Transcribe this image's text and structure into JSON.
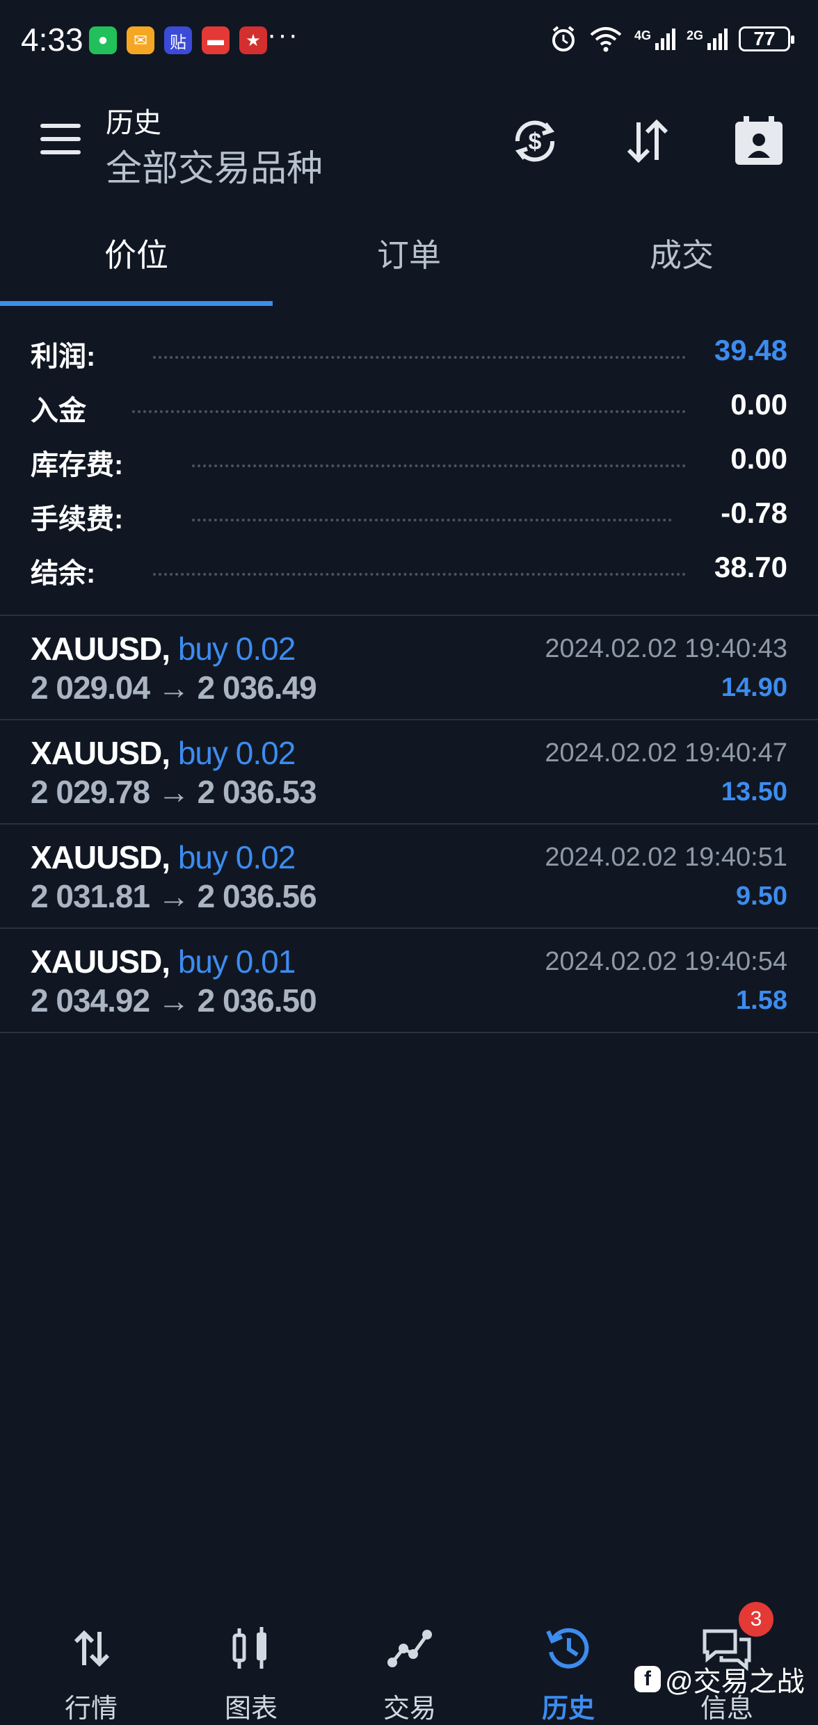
{
  "status_bar": {
    "time": "4:33",
    "battery": "77",
    "apps": [
      "wechat-icon",
      "mail-icon",
      "tieba-icon",
      "red-packet-icon",
      "game-icon"
    ],
    "more": "···",
    "net1": "4G",
    "net2": "2G"
  },
  "header": {
    "title": "历史",
    "subtitle": "全部交易品种"
  },
  "tabs": [
    {
      "label": "价位",
      "active": true
    },
    {
      "label": "订单",
      "active": false
    },
    {
      "label": "成交",
      "active": false
    }
  ],
  "summary": [
    {
      "label": "利润:",
      "value": "39.48",
      "highlight": true
    },
    {
      "label": "入金",
      "value": "0.00",
      "highlight": false
    },
    {
      "label": "库存费:",
      "value": "0.00",
      "highlight": false
    },
    {
      "label": "手续费:",
      "value": "-0.78",
      "highlight": false
    },
    {
      "label": "结余:",
      "value": "38.70",
      "highlight": false
    }
  ],
  "trades": [
    {
      "symbol": "XAUUSD,",
      "side": "buy 0.02",
      "open": "2 029.04",
      "close": "2 036.49",
      "time": "2024.02.02 19:40:43",
      "profit": "14.90"
    },
    {
      "symbol": "XAUUSD,",
      "side": "buy 0.02",
      "open": "2 029.78",
      "close": "2 036.53",
      "time": "2024.02.02 19:40:47",
      "profit": "13.50"
    },
    {
      "symbol": "XAUUSD,",
      "side": "buy 0.02",
      "open": "2 031.81",
      "close": "2 036.56",
      "time": "2024.02.02 19:40:51",
      "profit": "9.50"
    },
    {
      "symbol": "XAUUSD,",
      "side": "buy 0.01",
      "open": "2 034.92",
      "close": "2 036.50",
      "time": "2024.02.02 19:40:54",
      "profit": "1.58"
    }
  ],
  "arrow": "→",
  "bottom_nav": [
    {
      "label": "行情",
      "icon": "quotes-icon",
      "active": false
    },
    {
      "label": "图表",
      "icon": "chart-icon",
      "active": false
    },
    {
      "label": "交易",
      "icon": "trade-icon",
      "active": false
    },
    {
      "label": "历史",
      "icon": "history-icon",
      "active": true
    },
    {
      "label": "信息",
      "icon": "messages-icon",
      "active": false
    }
  ],
  "messages_badge": "3",
  "watermark": "@交易之战",
  "colors": {
    "accent": "#3d8cf0",
    "background": "#101722",
    "badge": "#e53935"
  }
}
